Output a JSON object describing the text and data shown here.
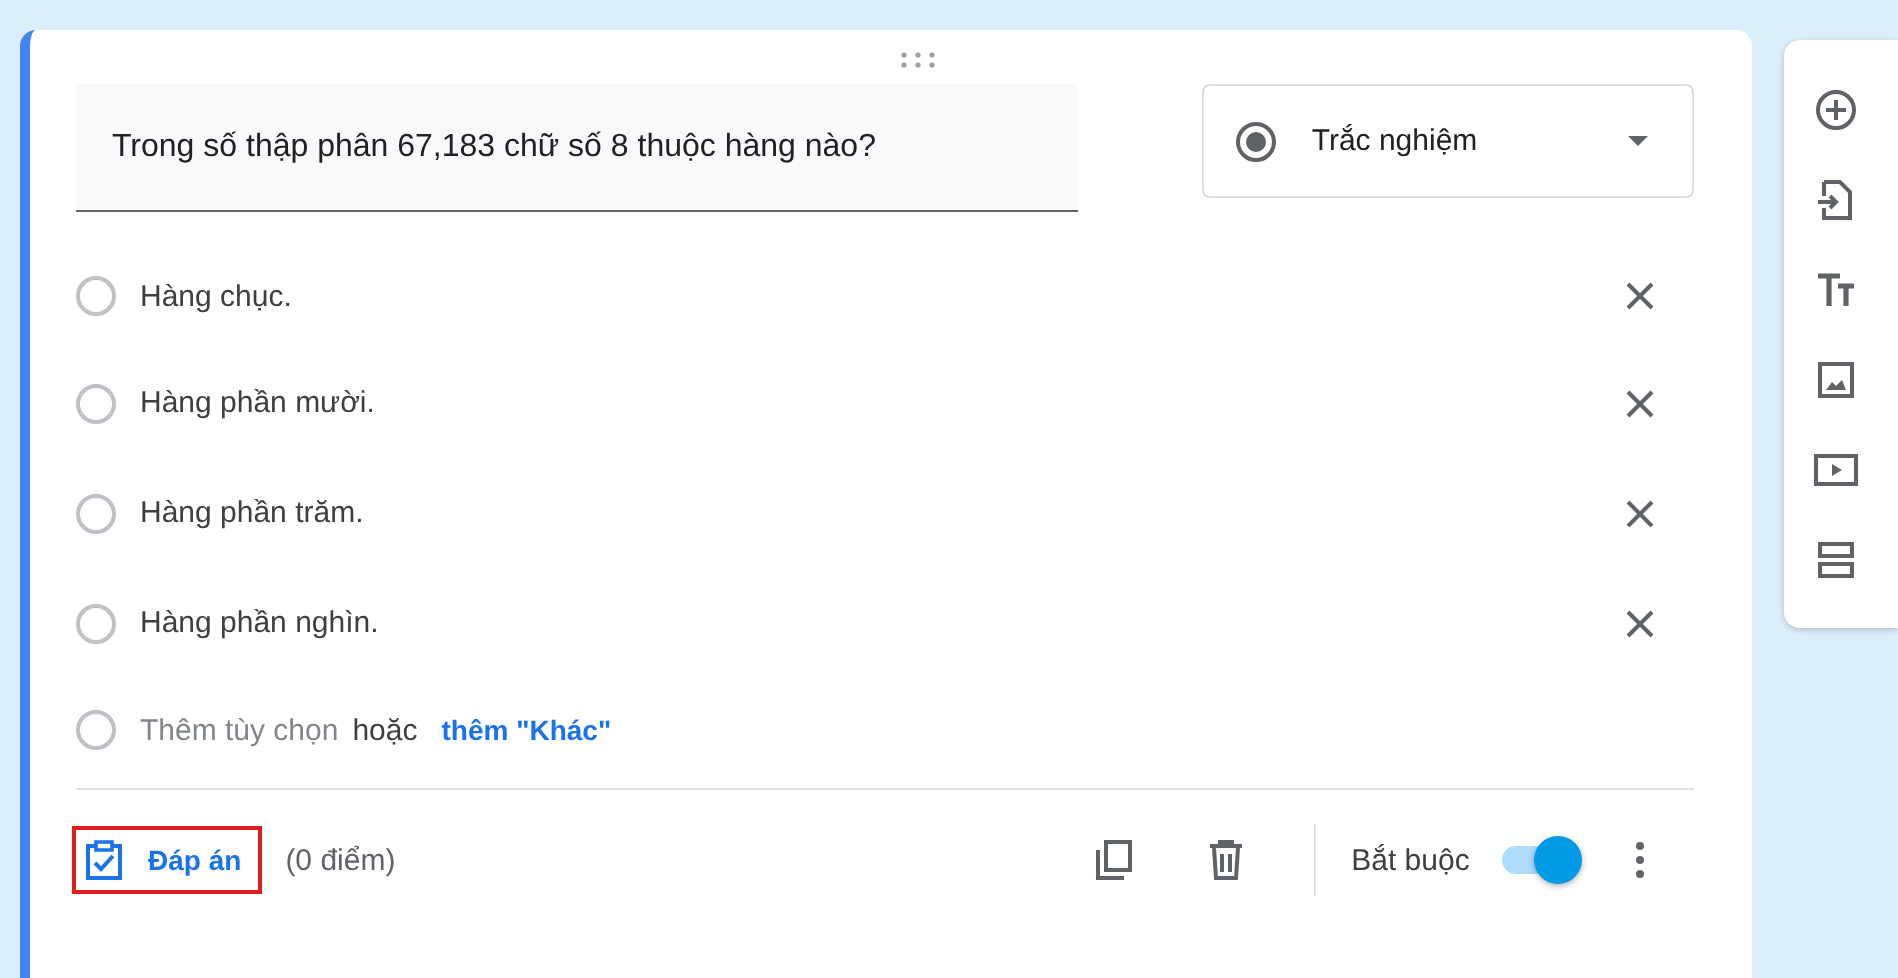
{
  "question": {
    "value": "Trong số thập phân 67,183 chữ số 8 thuộc hàng nào?"
  },
  "question_type": {
    "label": "Trắc nghiệm"
  },
  "options": [
    {
      "label": "Hàng chục.",
      "selected": false
    },
    {
      "label": "Hàng phần mười.",
      "selected": false
    },
    {
      "label": "Hàng phần trăm.",
      "selected": false
    },
    {
      "label": "Hàng phần nghìn.",
      "selected": false
    }
  ],
  "add_option": {
    "placeholder": "Thêm tùy chọn",
    "separator": "hoặc",
    "link": "thêm \"Khác\"",
    "selected": false
  },
  "footer": {
    "answer_key": {
      "label": "Đáp án",
      "highlighted": true
    },
    "points": "(0 điểm)",
    "required_label": "Bắt buộc",
    "required": true
  }
}
